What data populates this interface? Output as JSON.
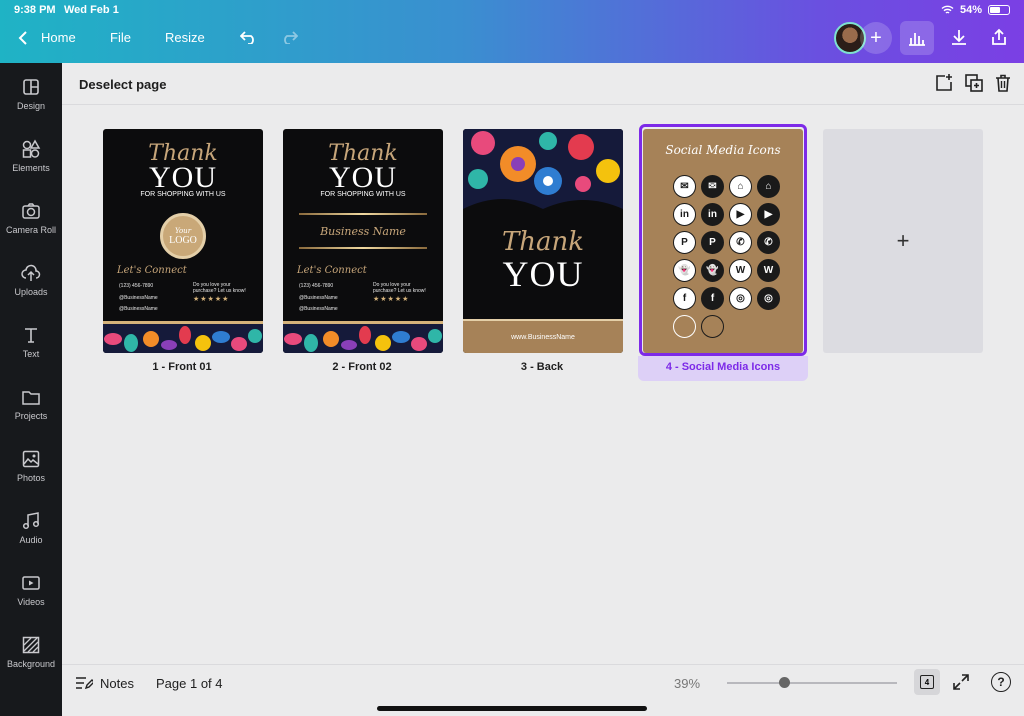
{
  "status_bar": {
    "time": "9:38 PM",
    "date": "Wed Feb 1",
    "battery": "54%"
  },
  "toolbar": {
    "home": "Home",
    "file": "File",
    "resize": "Resize"
  },
  "sidebar": {
    "items": [
      {
        "label": "Design"
      },
      {
        "label": "Elements"
      },
      {
        "label": "Camera Roll"
      },
      {
        "label": "Uploads"
      },
      {
        "label": "Text"
      },
      {
        "label": "Projects"
      },
      {
        "label": "Photos"
      },
      {
        "label": "Audio"
      },
      {
        "label": "Videos"
      },
      {
        "label": "Background"
      }
    ]
  },
  "header": {
    "deselect": "Deselect page"
  },
  "pages": [
    {
      "label": "1 - Front 01",
      "thank": "Thank",
      "you": "YOU",
      "shopping": "FOR SHOPPING WITH US",
      "logo_top": "Your",
      "logo_bottom": "LOGO",
      "connect": "Let's Connect",
      "phone": "(123) 456-7890",
      "handle1": "@BusinessName",
      "handle2": "@BusinessName",
      "love": "Do you love your purchase? Let us know!",
      "stars": "★★★★★"
    },
    {
      "label": "2 - Front 02",
      "thank": "Thank",
      "you": "YOU",
      "shopping": "FOR SHOPPING WITH US",
      "business": "Business Name",
      "connect": "Let's Connect",
      "phone": "(123) 456-7890",
      "handle1": "@BusinessName",
      "handle2": "@BusinessName",
      "love": "Do you love your purchase? Let us know!",
      "stars": "★★★★★"
    },
    {
      "label": "3 - Back",
      "thank": "Thank",
      "you": "YOU",
      "website": "www.BusinessName"
    },
    {
      "label": "4 - Social Media Icons",
      "title": "Social Media Icons",
      "icons": [
        "✉",
        "✉",
        "⌂",
        "⌂",
        "in",
        "in",
        "▶",
        "▶",
        "P",
        "P",
        "✆",
        "✆",
        "👻",
        "👻",
        "W",
        "W",
        "f",
        "f",
        "◎",
        "◎"
      ]
    }
  ],
  "add_page": "+",
  "footer": {
    "notes": "Notes",
    "page_indicator": "Page 1 of 4",
    "zoom": "39%",
    "page_count": "4",
    "help": "?"
  },
  "colors": {
    "accent": "#7d2ae8",
    "gold": "#c7a67a",
    "tan": "#a68258"
  }
}
